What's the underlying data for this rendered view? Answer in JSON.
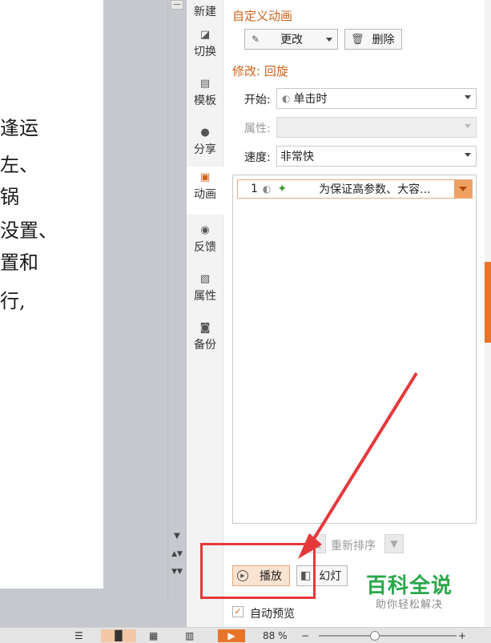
{
  "slide": {
    "lines": [
      "逢运",
      "左、",
      "锅",
      "没置、",
      "置和",
      "行,"
    ]
  },
  "sidetabs": [
    {
      "label": "新建",
      "icon": "new-icon"
    },
    {
      "label": "切换",
      "icon": "transition-icon"
    },
    {
      "label": "模板",
      "icon": "template-icon"
    },
    {
      "label": "分享",
      "icon": "share-icon"
    },
    {
      "label": "动画",
      "icon": "animation-icon",
      "active": true
    },
    {
      "label": "反馈",
      "icon": "feedback-icon"
    },
    {
      "label": "属性",
      "icon": "properties-icon"
    },
    {
      "label": "备份",
      "icon": "backup-icon"
    }
  ],
  "panel": {
    "title": "自定义动画",
    "change_label": "更改",
    "delete_label": "删除",
    "modify_title": "修改: 回旋",
    "start_label": "开始:",
    "start_value": "单击时",
    "property_label": "属性:",
    "property_value": "",
    "speed_label": "速度:",
    "speed_value": "非常快",
    "list_item": {
      "index": "1",
      "text": "为保证高参数、大容..."
    },
    "reorder_label": "重新排序",
    "play_label": "播放",
    "slideshow_label": "幻灯",
    "autopreview_label": "自动预览",
    "autopreview_checked": true
  },
  "statusbar": {
    "zoom": "88 %"
  },
  "watermark": {
    "title": "百科全说",
    "subtitle": "助你轻松解决"
  },
  "colors": {
    "accent": "#d0621a",
    "annotation": "#e5383b",
    "watermark_green": "#2aa74a"
  }
}
